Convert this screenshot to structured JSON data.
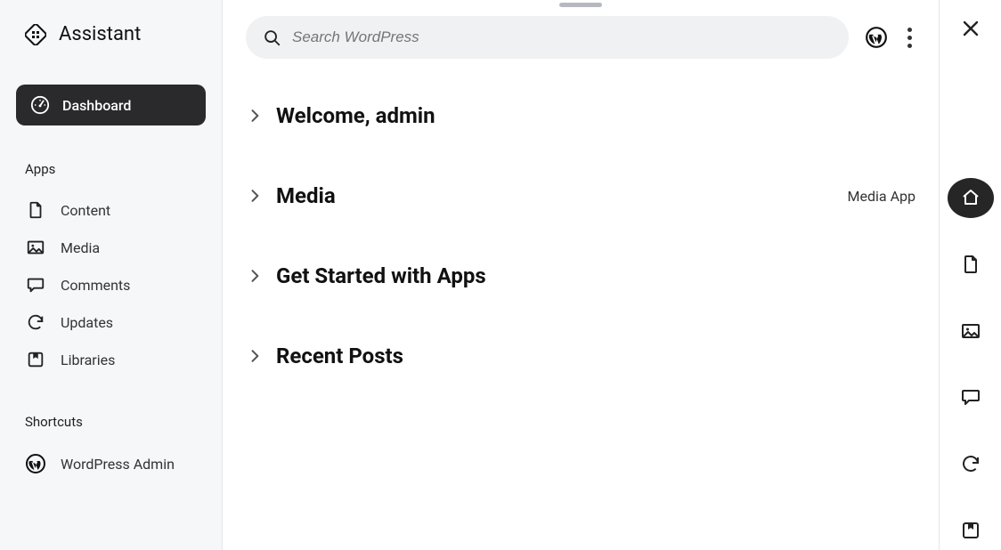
{
  "brand": {
    "title": "Assistant"
  },
  "sidebar": {
    "active": {
      "label": "Dashboard",
      "icon": "dashboard-icon"
    },
    "apps_label": "Apps",
    "apps": [
      {
        "label": "Content",
        "icon": "document-icon"
      },
      {
        "label": "Media",
        "icon": "image-icon"
      },
      {
        "label": "Comments",
        "icon": "comment-icon"
      },
      {
        "label": "Updates",
        "icon": "sync-icon"
      },
      {
        "label": "Libraries",
        "icon": "bookmark-folder-icon"
      }
    ],
    "shortcuts_label": "Shortcuts",
    "shortcuts": [
      {
        "label": "WordPress Admin",
        "icon": "wordpress-icon"
      }
    ]
  },
  "search": {
    "placeholder": "Search WordPress"
  },
  "topbar": {
    "wp_icon": "wordpress-icon",
    "more_icon": "more-vertical-icon"
  },
  "sections": [
    {
      "title": "Welcome, admin",
      "trailing": ""
    },
    {
      "title": "Media",
      "trailing": "Media App"
    },
    {
      "title": "Get Started with Apps",
      "trailing": ""
    },
    {
      "title": "Recent Posts",
      "trailing": ""
    }
  ],
  "rail": {
    "close_icon": "close-icon",
    "items": [
      {
        "icon": "home-icon",
        "active": true
      },
      {
        "icon": "document-icon",
        "active": false
      },
      {
        "icon": "image-icon",
        "active": false
      },
      {
        "icon": "comment-icon",
        "active": false
      },
      {
        "icon": "sync-icon",
        "active": false
      },
      {
        "icon": "bookmark-folder-icon",
        "active": false
      }
    ]
  }
}
